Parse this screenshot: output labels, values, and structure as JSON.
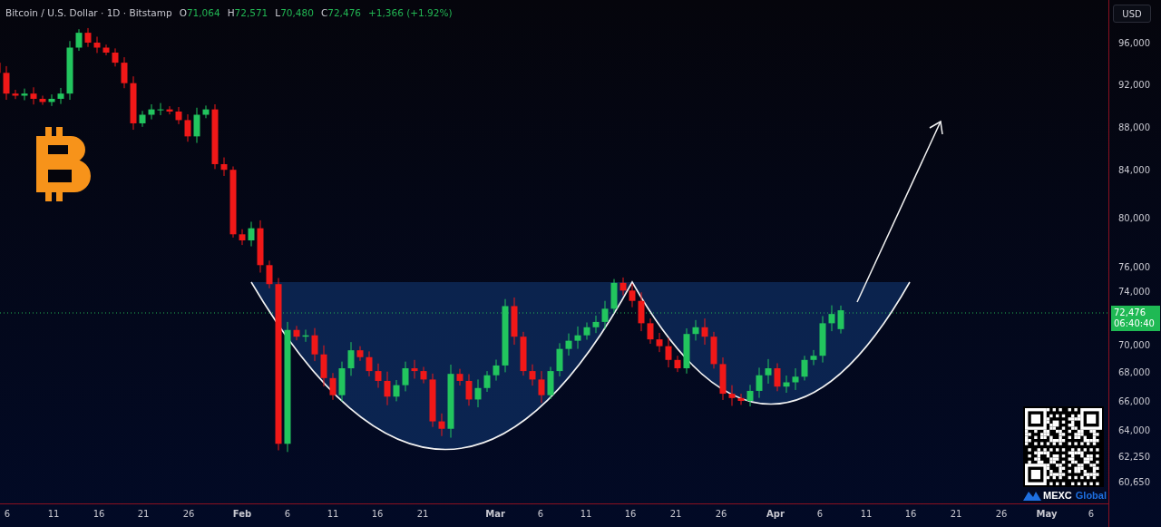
{
  "header": {
    "symbol": "Bitcoin / U.S. Dollar · 1D · Bitstamp",
    "ohlc": [
      {
        "label": "O",
        "value": "71,064"
      },
      {
        "label": "H",
        "value": "72,571"
      },
      {
        "label": "L",
        "value": "70,480"
      },
      {
        "label": "C",
        "value": "72,476"
      }
    ],
    "change": "+1,366 (+1.92%)"
  },
  "currency_button": "USD",
  "price_axis": [
    "96,000",
    "92,000",
    "88,000",
    "84,000",
    "80,000",
    "76,000",
    "74,000",
    "70,000",
    "68,000",
    "66,000",
    "64,000",
    "62,250",
    "60,650"
  ],
  "price_tag": {
    "price": "72,476",
    "countdown": "06:40:40"
  },
  "date_axis": [
    {
      "label": "6",
      "kind": "day"
    },
    {
      "label": "11",
      "kind": "day"
    },
    {
      "label": "16",
      "kind": "day"
    },
    {
      "label": "21",
      "kind": "day"
    },
    {
      "label": "26",
      "kind": "day"
    },
    {
      "label": "Feb",
      "kind": "month"
    },
    {
      "label": "6",
      "kind": "day"
    },
    {
      "label": "11",
      "kind": "day"
    },
    {
      "label": "16",
      "kind": "day"
    },
    {
      "label": "21",
      "kind": "day"
    },
    {
      "label": "Mar",
      "kind": "month"
    },
    {
      "label": "6",
      "kind": "day"
    },
    {
      "label": "11",
      "kind": "day"
    },
    {
      "label": "16",
      "kind": "day"
    },
    {
      "label": "21",
      "kind": "day"
    },
    {
      "label": "26",
      "kind": "day"
    },
    {
      "label": "Apr",
      "kind": "month"
    },
    {
      "label": "6",
      "kind": "day"
    },
    {
      "label": "11",
      "kind": "day"
    },
    {
      "label": "16",
      "kind": "day"
    },
    {
      "label": "21",
      "kind": "day"
    },
    {
      "label": "26",
      "kind": "day"
    },
    {
      "label": "May",
      "kind": "month"
    },
    {
      "label": "6",
      "kind": "day"
    }
  ],
  "watermark_brand": {
    "name": "MEXC",
    "suffix": "Global"
  }
}
